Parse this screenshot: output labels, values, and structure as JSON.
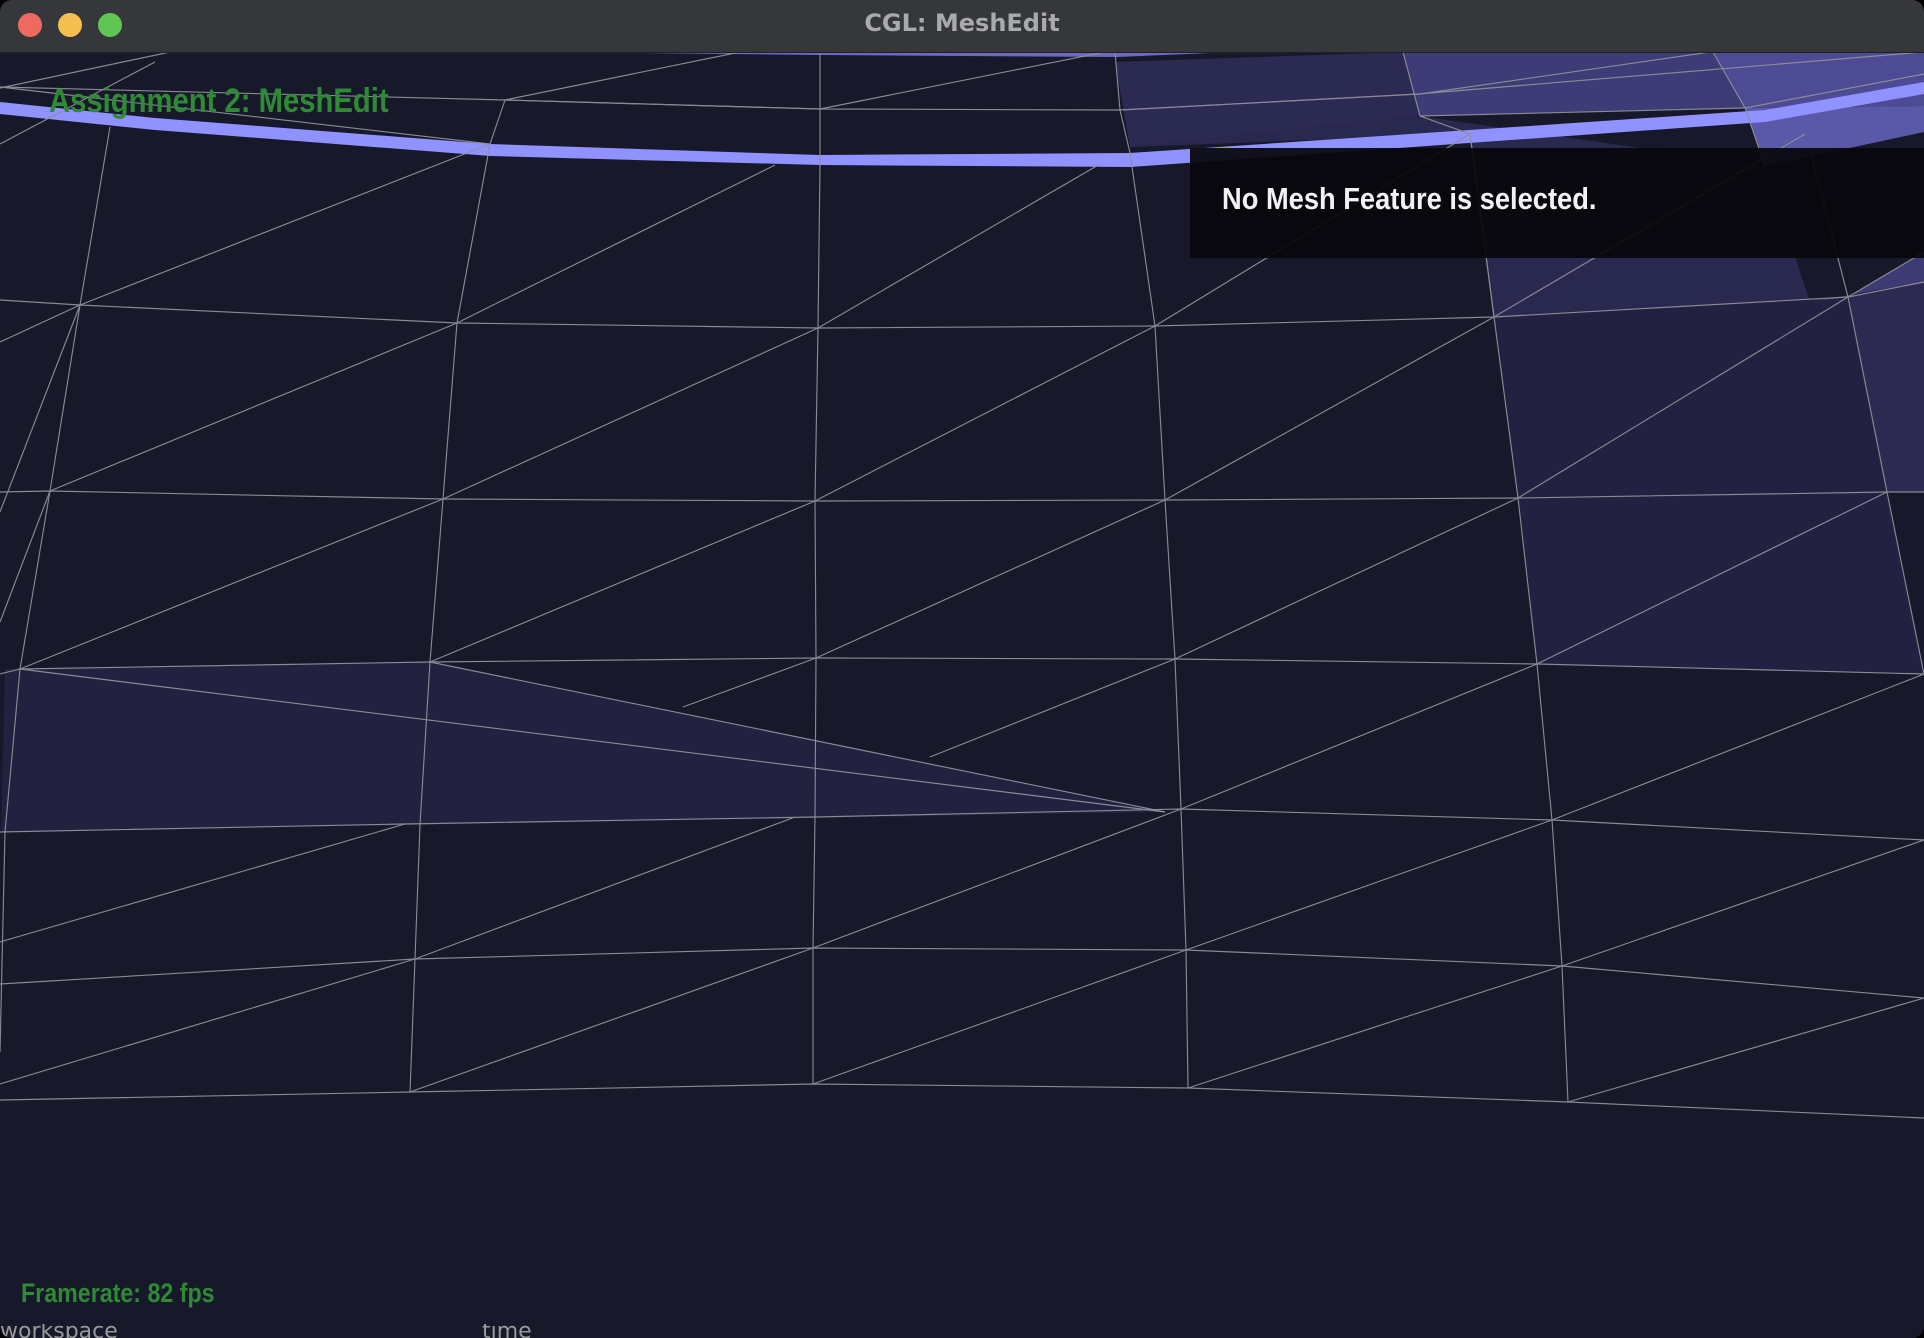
{
  "window": {
    "title": "CGL: MeshEdit"
  },
  "hud": {
    "title": "Assignment 2: MeshEdit",
    "selection_status": "No Mesh Feature is selected.",
    "framerate": "Framerate: 82 fps"
  },
  "colors": {
    "background": "#171829",
    "titlebar": "#35373a",
    "hud_green": "#2f8a35",
    "mesh_edge": "#8f9099",
    "boundary_highlight": "#8f92ff"
  },
  "icons": {
    "close": "close-icon",
    "minimize": "minimize-icon",
    "zoom": "zoom-icon"
  }
}
